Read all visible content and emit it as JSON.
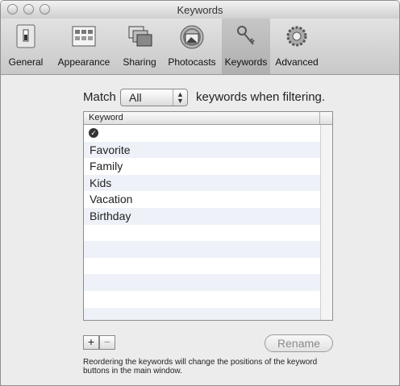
{
  "window": {
    "title": "Keywords"
  },
  "toolbar": {
    "items": [
      {
        "label": "General",
        "icon": "switch-icon"
      },
      {
        "label": "Appearance",
        "icon": "appearance-icon"
      },
      {
        "label": "Sharing",
        "icon": "sharing-icon"
      },
      {
        "label": "Photocasts",
        "icon": "photocasts-icon"
      },
      {
        "label": "Keywords",
        "icon": "key-icon",
        "selected": true
      },
      {
        "label": "Advanced",
        "icon": "gear-icon"
      }
    ]
  },
  "match": {
    "prefix": "Match",
    "selected": "All",
    "suffix": "keywords when filtering."
  },
  "table": {
    "header": "Keyword",
    "rows": [
      "",
      "Favorite",
      "Family",
      "Kids",
      "Vacation",
      "Birthday"
    ]
  },
  "buttons": {
    "add": "+",
    "remove": "−",
    "rename": "Rename"
  },
  "note": "Reordering the keywords will change the positions of the keyword buttons in the main window."
}
